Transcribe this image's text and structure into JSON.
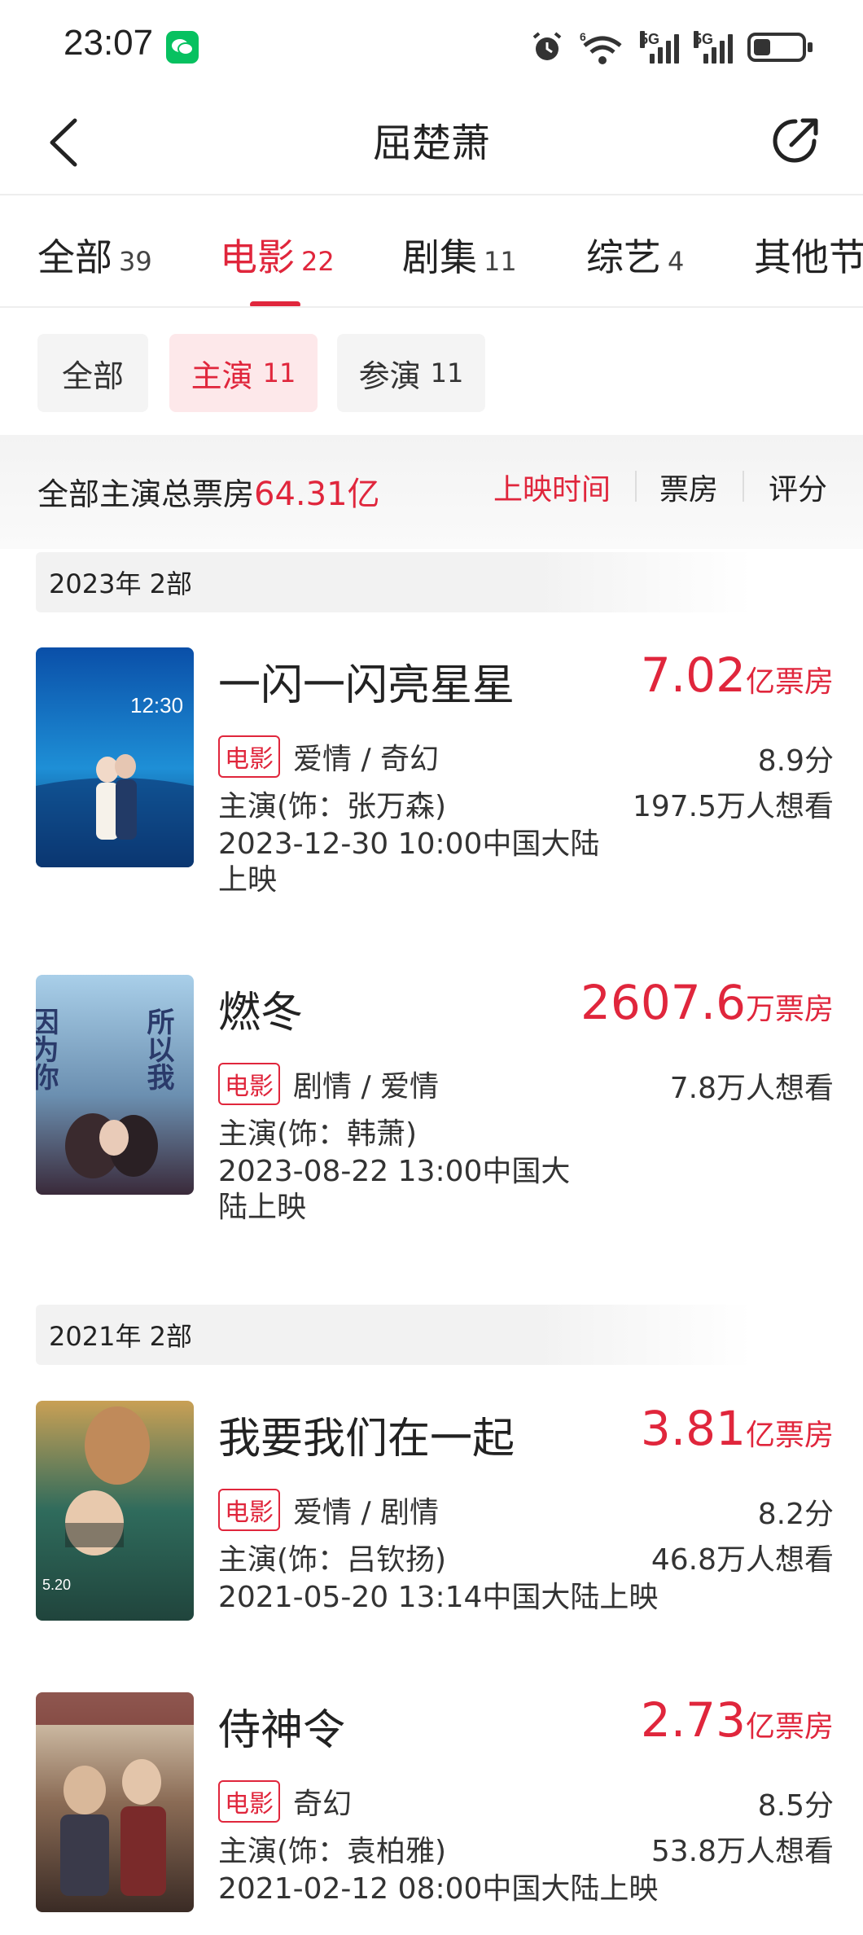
{
  "status_bar": {
    "time": "23:07",
    "net1": "5G",
    "net2": "5G",
    "wifi_label": "6",
    "battery_level": 0.35,
    "icons": [
      "wechat-icon",
      "alarm-icon",
      "wifi-icon",
      "signal-icon",
      "battery-icon"
    ]
  },
  "nav": {
    "title": "屈楚萧",
    "back_icon": "chevron-left-icon",
    "share_icon": "share-icon"
  },
  "tabs": [
    {
      "label": "全部",
      "count": "39"
    },
    {
      "label": "电影",
      "count": "22"
    },
    {
      "label": "剧集",
      "count": "11"
    },
    {
      "label": "综艺",
      "count": "4"
    },
    {
      "label": "其他节",
      "count": ""
    }
  ],
  "active_tab": 1,
  "chips": [
    {
      "label": "全部",
      "count": ""
    },
    {
      "label": "主演",
      "count": "11"
    },
    {
      "label": "参演",
      "count": "11"
    }
  ],
  "summary": {
    "label": "全部主演总票房",
    "value": "64.31亿",
    "sort_options": [
      "上映时间",
      "票房",
      "评分"
    ]
  },
  "groups": [
    {
      "header": "2023年  2部",
      "movies": [
        {
          "title": "一闪一闪亮星星",
          "box_value": "7.02",
          "box_unit": "亿票房",
          "tag": "电影",
          "genres": "爱情 / 奇幻",
          "score": "8.9分",
          "cast": "主演(饰：张万森)",
          "want": "197.5万人想看",
          "date": "2023-12-30 10:00中国大陆上映"
        },
        {
          "title": "燃冬",
          "box_value": "2607.6",
          "box_unit": "万票房",
          "tag": "电影",
          "genres": "剧情 / 爱情",
          "score": "",
          "cast": "主演(饰：韩萧)",
          "want": "7.8万人想看",
          "date": "2023-08-22 13:00中国大陆上映"
        }
      ]
    },
    {
      "header": "2021年  2部",
      "movies": [
        {
          "title": "我要我们在一起",
          "box_value": "3.81",
          "box_unit": "亿票房",
          "tag": "电影",
          "genres": "爱情 / 剧情",
          "score": "8.2分",
          "cast": "主演(饰：吕钦扬)",
          "want": "46.8万人想看",
          "date": "2021-05-20 13:14中国大陆上映"
        },
        {
          "title": "侍神令",
          "box_value": "2.73",
          "box_unit": "亿票房",
          "tag": "电影",
          "genres": "奇幻",
          "score": "8.5分",
          "cast": "主演(饰：袁柏雅)",
          "want": "53.8万人想看",
          "date": "2021-02-12 08:00中国大陆上映"
        }
      ]
    }
  ],
  "posters": [
    {
      "text": "12:30",
      "palette": [
        "#0a4fa8",
        "#1e8fd6",
        "#0b2a5a"
      ]
    },
    {
      "text_left": "因为你",
      "text_right": "所以我",
      "palette": [
        "#9fc7e6",
        "#6b8fb0",
        "#3a2a3a"
      ]
    },
    {
      "text": "5.20",
      "palette": [
        "#c9a055",
        "#2f6b5c",
        "#20443c"
      ]
    },
    {
      "text": "",
      "palette": [
        "#e6d8c0",
        "#8a6b55",
        "#3a2b25"
      ]
    }
  ],
  "colors": {
    "accent": "#e0263c",
    "text": "#222222",
    "chip_bg": "#f4f4f4",
    "chip_active_bg": "#fde8ea"
  }
}
